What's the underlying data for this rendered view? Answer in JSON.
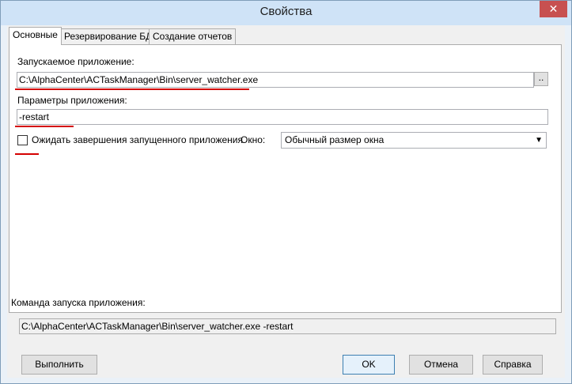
{
  "window": {
    "title": "Свойства",
    "close_label": "✕"
  },
  "tabs": [
    {
      "label": "Основные"
    },
    {
      "label": "Резервирование БД"
    },
    {
      "label": "Создание отчетов"
    }
  ],
  "main": {
    "app_label": "Запускаемое приложение:",
    "app_path": "C:\\AlphaCenter\\ACTaskManager\\Bin\\server_watcher.exe",
    "browse_label": "..",
    "params_label": "Параметры приложения:",
    "params_value": "-restart",
    "wait_label": "Ожидать завершения запущенного приложения",
    "wait_checked": false,
    "window_label": "Окно:",
    "window_mode_value": "Обычный размер окна"
  },
  "command": {
    "label": "Команда запуска приложения:",
    "value": "C:\\AlphaCenter\\ACTaskManager\\Bin\\server_watcher.exe -restart"
  },
  "buttons": {
    "run": "Выполнить",
    "ok": "OK",
    "cancel": "Отмена",
    "help": "Справка"
  },
  "colors": {
    "annotation": "#d40000",
    "close_button": "#c75050",
    "titlebar": "#cfe3f7"
  }
}
